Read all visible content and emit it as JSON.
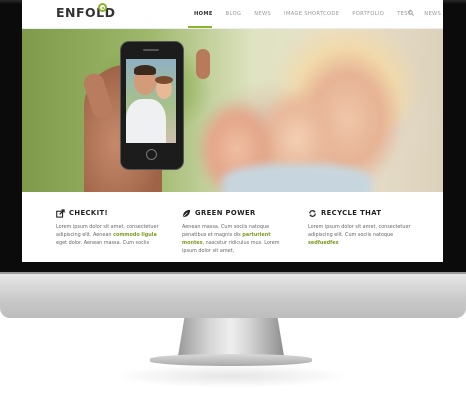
{
  "site": {
    "logo": "ENFOLD",
    "nav": [
      "HOME",
      "BLOG",
      "NEWS",
      "IMAGE SHORTCODE",
      "PORTFOLIO",
      "TEST",
      "NEWS"
    ],
    "active_nav": "HOME"
  },
  "features": [
    {
      "title": "CHECKIT!",
      "icon": "share-icon",
      "text_before": "Lorem ipsum dolor sit amet, consectetuer adipiscing elit. Aenean ",
      "highlight": "commodo ligula",
      "text_after": " eget dolor. Aenean massa. Cum sociis"
    },
    {
      "title": "GREEN POWER",
      "icon": "leaf-icon",
      "text_before": "Aenean massa. Cum sociis natoque penatibus et magnis dis ",
      "highlight": "parturient montes",
      "text_after": ", nascetur ridiculus mus. Lorem ipsum dolor sit amet,"
    },
    {
      "title": "RECYCLE THAT",
      "icon": "recycle-icon",
      "text_before": "Lorem ipsum dolor sit amet, consectetuer adipiscing elit. Cum sociis natoque ",
      "highlight": "sedfuedfes",
      "text_after": ""
    }
  ],
  "colors": {
    "accent": "#8ab42b",
    "bezel": "#0b0b0b"
  }
}
